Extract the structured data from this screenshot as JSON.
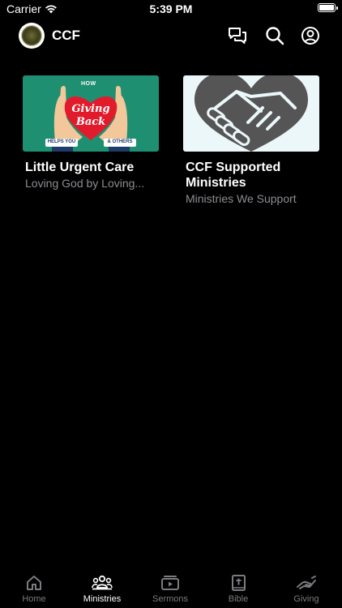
{
  "status_bar": {
    "carrier": "Carrier",
    "time": "5:39 PM"
  },
  "header": {
    "title": "CCF",
    "icons": [
      "chat-icon",
      "search-icon",
      "profile-icon"
    ]
  },
  "cards": [
    {
      "title": "Little Urgent Care",
      "subtitle": "Loving God by Loving...",
      "image_text": {
        "top": "HOW",
        "line1": "Giving",
        "line2": "Back",
        "left_tag": "HELPS YOU",
        "right_tag": "& OTHERS"
      }
    },
    {
      "title": "CCF Supported Ministries",
      "subtitle": "Ministries We Support"
    }
  ],
  "tabs": [
    {
      "label": "Home",
      "icon": "home-icon",
      "active": false
    },
    {
      "label": "Ministries",
      "icon": "people-icon",
      "active": true
    },
    {
      "label": "Sermons",
      "icon": "video-icon",
      "active": false
    },
    {
      "label": "Bible",
      "icon": "bible-icon",
      "active": false
    },
    {
      "label": "Giving",
      "icon": "giving-hand-icon",
      "active": false
    }
  ],
  "colors": {
    "background": "#000000",
    "inactive_tab": "#7b7b80",
    "subtitle": "#8d8d93",
    "card1_bg": "#1f8f72",
    "heart": "#e21b2c"
  }
}
